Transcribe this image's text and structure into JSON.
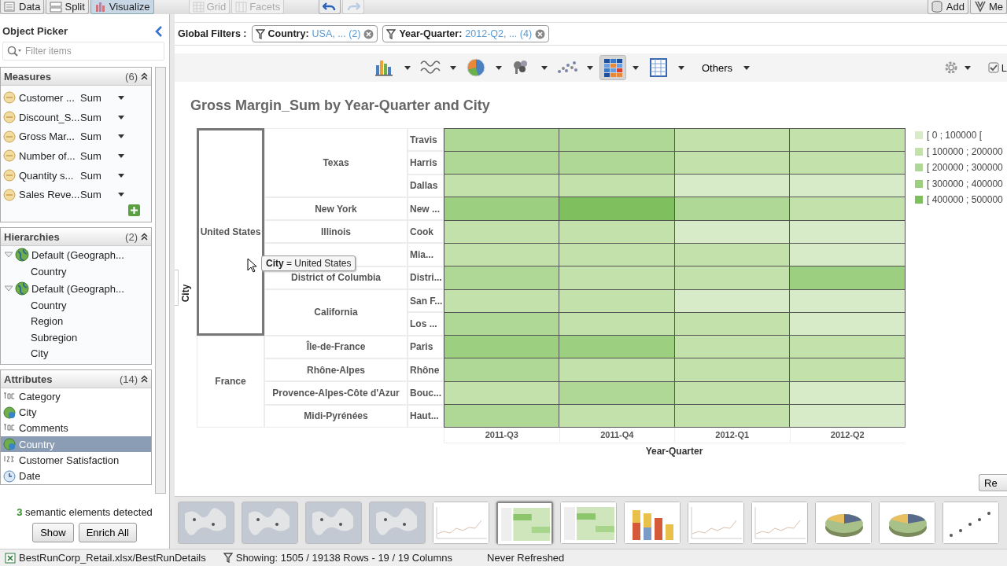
{
  "top_toolbar": {
    "view_tabs": [
      {
        "label": "Data",
        "selected": false
      },
      {
        "label": "Split",
        "selected": false
      },
      {
        "label": "Visualize",
        "selected": true
      }
    ],
    "layout_buttons": [
      {
        "label": "Grid",
        "disabled": true
      },
      {
        "label": "Facets",
        "disabled": true
      }
    ],
    "right_buttons": [
      "Add",
      "Me"
    ]
  },
  "object_picker": {
    "title": "Object Picker",
    "search": {
      "placeholder": "Filter items"
    },
    "measures": {
      "title": "Measures",
      "count": "(6)",
      "items": [
        {
          "name": "Customer ...",
          "aggregation": "Sum"
        },
        {
          "name": "Discount_S...",
          "aggregation": "Sum"
        },
        {
          "name": "Gross Mar...",
          "aggregation": "Sum"
        },
        {
          "name": "Number of...",
          "aggregation": "Sum"
        },
        {
          "name": "Quantity s...",
          "aggregation": "Sum"
        },
        {
          "name": "Sales Reve...",
          "aggregation": "Sum"
        }
      ]
    },
    "hierarchies": {
      "title": "Hierarchies",
      "count": "(2)",
      "items": [
        {
          "label": "Default (Geograph...",
          "expanded": true,
          "children": [
            {
              "label": "Country"
            }
          ]
        },
        {
          "label": "Default (Geograph...",
          "expanded": true,
          "children": [
            {
              "label": "Country"
            },
            {
              "label": "Region"
            },
            {
              "label": "Subregion"
            },
            {
              "label": "City"
            }
          ]
        }
      ]
    },
    "attributes": {
      "title": "Attributes",
      "count": "(14)",
      "items": [
        {
          "label": "Category",
          "kind": "text",
          "selected": false
        },
        {
          "label": "City",
          "kind": "geo",
          "selected": false
        },
        {
          "label": "Comments",
          "kind": "text",
          "selected": false
        },
        {
          "label": "Country",
          "kind": "geo",
          "selected": true
        },
        {
          "label": "Customer Satisfaction",
          "kind": "number",
          "selected": false
        },
        {
          "label": "Date",
          "kind": "date",
          "selected": false
        }
      ]
    },
    "semantic": {
      "message": "**3** semantic elements detected",
      "buttons": [
        "Show",
        "Enrich All"
      ]
    }
  },
  "global_filters": {
    "label": "Global Filters :",
    "filters": [
      {
        "field": "Country:",
        "value": "USA, ... (2)"
      },
      {
        "field": "Year-Quarter:",
        "value": "2012-Q2, ... (4)"
      }
    ]
  },
  "chart_toolbar": {
    "chart_types": [
      {
        "kind": "bar",
        "selected": false
      },
      {
        "kind": "line",
        "selected": false
      },
      {
        "kind": "pie",
        "selected": false
      },
      {
        "kind": "map",
        "selected": false
      },
      {
        "kind": "scatter",
        "selected": false
      },
      {
        "kind": "heatmap",
        "selected": true
      },
      {
        "kind": "table",
        "selected": false
      }
    ],
    "others": "Others",
    "option_checkbox": {
      "label": "L",
      "checked": true
    }
  },
  "chart": {
    "title": "Gross Margin_Sum by Year-Quarter and City",
    "y_axis_title": "City",
    "x_axis_title": "Year-Quarter",
    "columns": [
      "2011-Q3",
      "2011-Q4",
      "2012-Q1",
      "2012-Q2"
    ],
    "countries": [
      {
        "name": "United States",
        "highlighted": true,
        "states": [
          {
            "name": "Texas",
            "cities": [
              {
                "name": "Travis",
                "cells": [
                  {
                    "color": "#afd896"
                  },
                  {
                    "color": "#afd896"
                  },
                  {
                    "color": "#c3e2ab"
                  },
                  {
                    "color": "#c3e2ab"
                  }
                ]
              },
              {
                "name": "Harris",
                "cells": [
                  {
                    "color": "#afd896"
                  },
                  {
                    "color": "#afd896"
                  },
                  {
                    "color": "#c3e2ab"
                  },
                  {
                    "color": "#c3e2ab"
                  }
                ]
              },
              {
                "name": "Dallas",
                "cells": [
                  {
                    "color": "#c3e2ab"
                  },
                  {
                    "color": "#c3e2ab"
                  },
                  {
                    "color": "#d7ebc8"
                  },
                  {
                    "color": "#d7ebc8"
                  }
                ]
              }
            ]
          },
          {
            "name": "New York",
            "cities": [
              {
                "name": "New ...",
                "cells": [
                  {
                    "color": "#9ccf80"
                  },
                  {
                    "color": "#7fbf5e"
                  },
                  {
                    "color": "#afd896"
                  },
                  {
                    "color": "#c3e2ab"
                  }
                ]
              }
            ]
          },
          {
            "name": "Illinois",
            "cities": [
              {
                "name": "Cook",
                "cells": [
                  {
                    "color": "#c3e2ab"
                  },
                  {
                    "color": "#c3e2ab"
                  },
                  {
                    "color": "#d7ebc8"
                  },
                  {
                    "color": "#d7ebc8"
                  }
                ]
              }
            ]
          },
          {
            "cities": [
              {
                "name": "Mia...",
                "cells": [
                  {
                    "color": "#c3e2ab"
                  },
                  {
                    "color": "#c3e2ab"
                  },
                  {
                    "color": "#c3e2ab"
                  },
                  {
                    "color": "#d7ebc8"
                  }
                ]
              }
            ]
          },
          {
            "name": "District of Columbia",
            "cities": [
              {
                "name": "Distri...",
                "cells": [
                  {
                    "color": "#afd896"
                  },
                  {
                    "color": "#c3e2ab"
                  },
                  {
                    "color": "#c3e2ab"
                  },
                  {
                    "color": "#9ccf80"
                  }
                ]
              }
            ]
          },
          {
            "name": "California",
            "cities": [
              {
                "name": "San F...",
                "cells": [
                  {
                    "color": "#c3e2ab"
                  },
                  {
                    "color": "#c3e2ab"
                  },
                  {
                    "color": "#d7ebc8"
                  },
                  {
                    "color": "#d7ebc8"
                  }
                ]
              },
              {
                "name": "Los ...",
                "cells": [
                  {
                    "color": "#afd896"
                  },
                  {
                    "color": "#c3e2ab"
                  },
                  {
                    "color": "#c3e2ab"
                  },
                  {
                    "color": "#d7ebc8"
                  }
                ]
              }
            ]
          }
        ]
      },
      {
        "name": "France",
        "highlighted": false,
        "states": [
          {
            "name": "Île-de-France",
            "cities": [
              {
                "name": "Paris",
                "cells": [
                  {
                    "color": "#9ccf80"
                  },
                  {
                    "color": "#9ccf80"
                  },
                  {
                    "color": "#c3e2ab"
                  },
                  {
                    "color": "#c3e2ab"
                  }
                ]
              }
            ]
          },
          {
            "name": "Rhône-Alpes",
            "cities": [
              {
                "name": "Rhône",
                "cells": [
                  {
                    "color": "#afd896"
                  },
                  {
                    "color": "#c3e2ab"
                  },
                  {
                    "color": "#c3e2ab"
                  },
                  {
                    "color": "#c3e2ab"
                  }
                ]
              }
            ]
          },
          {
            "name": "Provence-Alpes-Côte d'Azur",
            "cities": [
              {
                "name": "Bouc...",
                "cells": [
                  {
                    "color": "#c3e2ab"
                  },
                  {
                    "color": "#afd896"
                  },
                  {
                    "color": "#c3e2ab"
                  },
                  {
                    "color": "#d7ebc8"
                  }
                ]
              }
            ]
          },
          {
            "name": "Midi-Pyrénées",
            "cities": [
              {
                "name": "Haut...",
                "cells": [
                  {
                    "color": "#afd896"
                  },
                  {
                    "color": "#c3e2ab"
                  },
                  {
                    "color": "#c3e2ab"
                  },
                  {
                    "color": "#d7ebc8"
                  }
                ]
              }
            ]
          }
        ]
      }
    ],
    "legend": [
      {
        "label": "[ 0 ; 100000 [",
        "color": "#d7ebc8"
      },
      {
        "label": "[ 100000 ; 200000",
        "color": "#c3e2ab"
      },
      {
        "label": "[ 200000 ; 300000",
        "color": "#afd896"
      },
      {
        "label": "[ 300000 ; 400000",
        "color": "#9ccf80"
      },
      {
        "label": "[ 400000 ; 500000",
        "color": "#7fbf5e"
      }
    ],
    "tooltip": "**City** = United States"
  },
  "reset_button": "Re",
  "thumbnails": [
    {
      "kind": "map",
      "selected": false
    },
    {
      "kind": "map",
      "selected": false
    },
    {
      "kind": "map",
      "selected": false
    },
    {
      "kind": "map",
      "selected": false
    },
    {
      "kind": "line",
      "selected": false
    },
    {
      "kind": "heatmap",
      "selected": true
    },
    {
      "kind": "heatmap",
      "selected": false
    },
    {
      "kind": "bar",
      "selected": false
    },
    {
      "kind": "line",
      "selected": false
    },
    {
      "kind": "line",
      "selected": false
    },
    {
      "kind": "pie",
      "selected": false
    },
    {
      "kind": "pie",
      "selected": false
    },
    {
      "kind": "scatter",
      "selected": false
    }
  ],
  "status_bar": {
    "source": "BestRunCorp_Retail.xlsx/BestRunDetails",
    "rows": "Showing: 1505 / 19138 Rows - 19 / 19 Columns",
    "refresh": "Never Refreshed"
  }
}
